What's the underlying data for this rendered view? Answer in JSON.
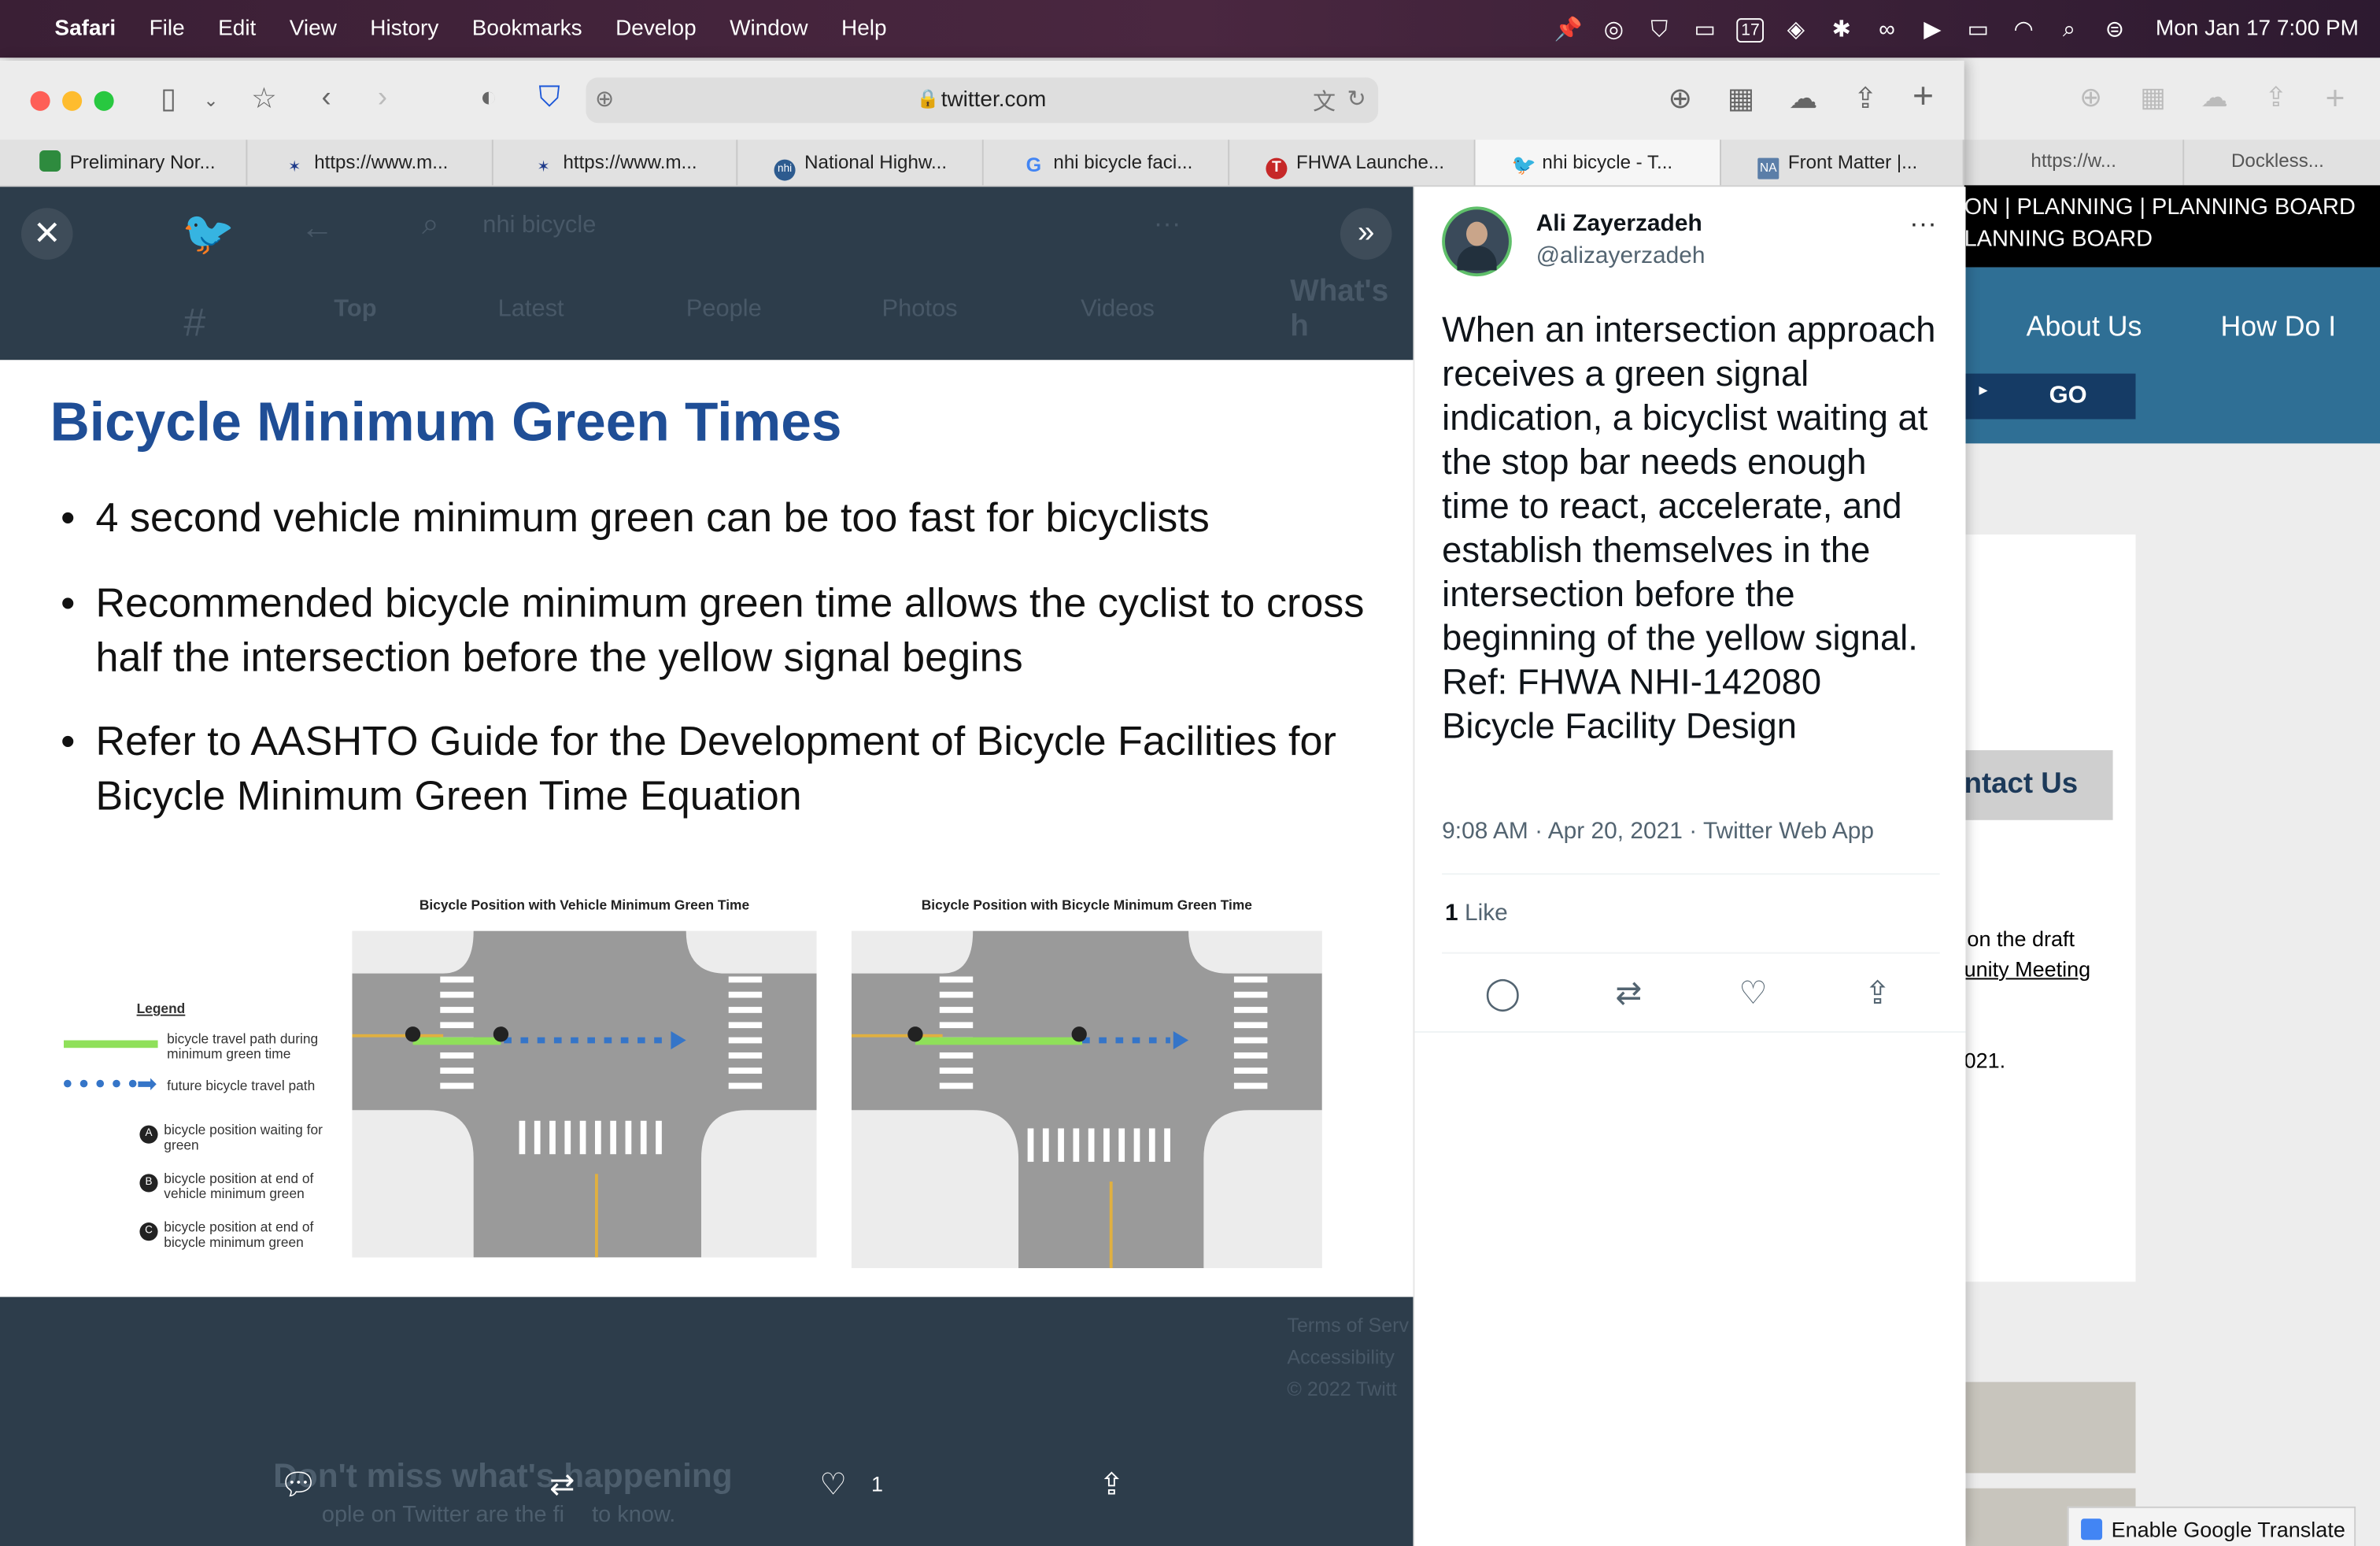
{
  "menubar": {
    "app": "Safari",
    "items": [
      "File",
      "Edit",
      "View",
      "History",
      "Bookmarks",
      "Develop",
      "Window",
      "Help"
    ],
    "calendar_day": "17",
    "clock": "Mon Jan 17  7:00 PM"
  },
  "toolbar": {
    "url": "twitter.com"
  },
  "tabs": [
    {
      "label": "Preliminary Nor...",
      "icon": "map-favicon",
      "color": "#2e8b3e"
    },
    {
      "label": "https://www.m...",
      "icon": "star-favicon",
      "color": "#1e3a8a"
    },
    {
      "label": "https://www.m...",
      "icon": "star-favicon",
      "color": "#1e3a8a"
    },
    {
      "label": "National Highw...",
      "icon": "nhi-favicon",
      "color": "#2d5b8f"
    },
    {
      "label": "nhi bicycle faci...",
      "icon": "google-favicon",
      "color": "#4285f4"
    },
    {
      "label": "FHWA Launche...",
      "icon": "t-favicon",
      "color": "#c62828"
    },
    {
      "label": "nhi bicycle - T...",
      "icon": "twitter-favicon",
      "color": "#1d9bf0",
      "active": true
    },
    {
      "label": "Front Matter |...",
      "icon": "na-favicon",
      "color": "#5b7ea8"
    }
  ],
  "back_window": {
    "tab1": "https://w...",
    "tab2": "Dockless...",
    "nav_line1": "ON  |  PLANNING  |  PLANNING BOARD",
    "nav_line2": "LANNING BOARD",
    "about": "About Us",
    "how": "How Do I",
    "go": "GO",
    "contact": "ntact Us",
    "text1": "on the draft",
    "text2": "unity Meeting",
    "text3": "021.",
    "translate": "Enable Google Translate"
  },
  "background_ghost": {
    "search": "nhi bicycle",
    "tabs": [
      "Top",
      "Latest",
      "People",
      "Photos",
      "Videos"
    ],
    "whats": "What's h",
    "dont_miss": "Don't miss what's happening",
    "people": "ople on Twitter are the fi",
    "know": "to know.",
    "terms": "Terms of Serv",
    "access": "Accessibility",
    "copyright": "© 2022 Twitt"
  },
  "slide": {
    "title": "Bicycle Minimum Green Times",
    "bullets": [
      "4 second vehicle minimum green can be too fast for bicyclists",
      "Recommended bicycle minimum green time allows the cyclist to cross half the intersection before the yellow signal begins",
      "Refer to AASHTO Guide for the Development of Bicycle Facilities for Bicycle Minimum Green Time Equation"
    ],
    "legend": {
      "title": "Legend",
      "items": [
        "bicycle travel path during minimum green time",
        "future bicycle travel path",
        "bicycle position waiting for green",
        "bicycle position at end of vehicle minimum green",
        "bicycle position at end of bicycle minimum green"
      ]
    },
    "diagram1_caption": "Bicycle Position with Vehicle Minimum Green Time",
    "diagram2_caption": "Bicycle Position with Bicycle Minimum Green Time"
  },
  "overlay_actions": {
    "like_count": "1"
  },
  "tweet": {
    "name": "Ali Zayerzadeh",
    "handle": "@alizayerzadeh",
    "text_lines": [
      "When an intersection approach receives a green signal indication, a bicyclist waiting at the stop bar needs enough time to react, accelerate, and establish themselves in the intersection before the beginning of the yellow signal.",
      "Ref: FHWA NHI-142080 Bicycle Facility Design"
    ],
    "meta": "9:08 AM · Apr 20, 2021 · Twitter Web App",
    "likes_count": "1",
    "likes_label": "Like"
  }
}
